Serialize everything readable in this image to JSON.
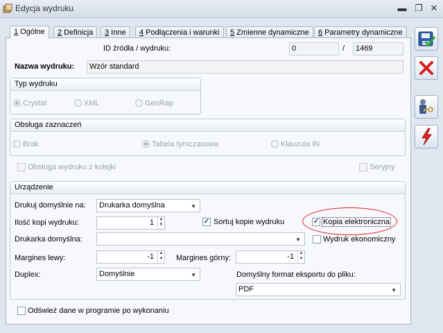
{
  "window": {
    "title": "Edycja wydruku",
    "minimize": "▬",
    "restore": "❐",
    "close": "✕"
  },
  "tabs": [
    {
      "num": "1",
      "label": " Ogólne"
    },
    {
      "num": "2",
      "label": " Definicja"
    },
    {
      "num": "3",
      "label": " Inne"
    },
    {
      "num": "4",
      "label": " Podłączenia i warunki"
    },
    {
      "num": "5",
      "label": " Zmienne dynamiczne"
    },
    {
      "num": "6",
      "label": " Parametry dynamiczne"
    }
  ],
  "source": {
    "label": "ID źródła / wydruku:",
    "source_id": "0",
    "separator": "/",
    "print_id": "1469"
  },
  "name": {
    "label": "Nazwa wydruku:",
    "value": "Wzór standard"
  },
  "print_type": {
    "title": "Typ wydruku",
    "options": [
      "Crystal",
      "XML",
      "GenRap"
    ]
  },
  "selection_handling": {
    "title": "Obsługa zaznaczeń",
    "options": [
      "Brak",
      "Tabela tymczasowa",
      "Klauzula IN"
    ]
  },
  "queue_label": "Obsługa wydruku z kolejki",
  "serial_label": "Seryjny",
  "device": {
    "title": "Urządzenie",
    "default_print_label": "Drukuj domyślnie na:",
    "default_print_value": "Drukarka domyślna",
    "copies_label": "Ilość kopi wydruku:",
    "copies_value": "1",
    "sort_label": "Sortuj kopie wydruku",
    "electronic_copy_label": "Kopia elektroniczna",
    "default_printer_label": "Drukarka domyślna:",
    "default_printer_value": "",
    "eco_label": "Wydruk ekonomiczny",
    "margin_left_label": "Margines lewy:",
    "margin_left_value": "-1",
    "margin_top_label": "Margines górny:",
    "margin_top_value": "-1",
    "duplex_label": "Duplex:",
    "duplex_value": "Domyślnie",
    "export_format_label": "Domyślny format eksportu do pliku:",
    "export_format_value": "PDF"
  },
  "refresh_label": "Odśwież dane w programie po wykonaniu",
  "icons": {
    "save": "save-icon",
    "cancel": "cancel-icon",
    "user": "user-key-icon",
    "flash": "lightning-icon"
  },
  "colors": {
    "accent": "#1d4f9c",
    "cancel_red": "#d61f1f",
    "highlight": "#e02020"
  }
}
